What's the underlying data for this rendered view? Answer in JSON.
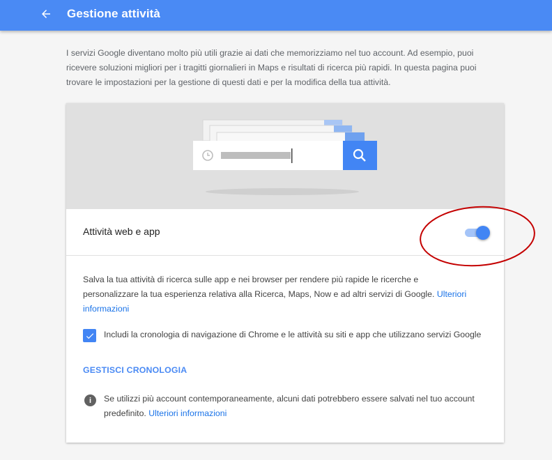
{
  "header": {
    "title": "Gestione attività",
    "back_icon": "arrow-back-icon",
    "color": "#4a8af4"
  },
  "intro": {
    "text": "I servizi Google diventano molto più utili grazie ai dati che memorizziamo nel tuo account. Ad esempio, puoi ricevere soluzioni migliori per i tragitti giornalieri in Maps e risultati di ricerca più rapidi. In questa pagina puoi trovare le impostazioni per la gestione di questi dati e per la modifica della tua attività."
  },
  "setting": {
    "label": "Attività web e app",
    "toggle_on": true,
    "description": "Salva la tua attività di ricerca sulle app e nei browser per rendere più rapide le ricerche e personalizzare la tua esperienza relativa alla Ricerca, Maps, Now e ad altri servizi di Google. ",
    "learn_more": "Ulteriori informazioni",
    "checkbox_checked": true,
    "checkbox_label": "Includi la cronologia di navigazione di Chrome e le attività su siti e app che utilizzano servizi Google",
    "manage_link": "GESTISCI CRONOLOGIA",
    "info_text": "Se utilizzi più account contemporaneamente, alcuni dati potrebbero essere salvati nel tuo account predefinito. ",
    "info_link": "Ulteriori informazioni"
  },
  "colors": {
    "accent": "#4285f4",
    "link": "#1a73e8",
    "annotation": "#cc0000"
  }
}
